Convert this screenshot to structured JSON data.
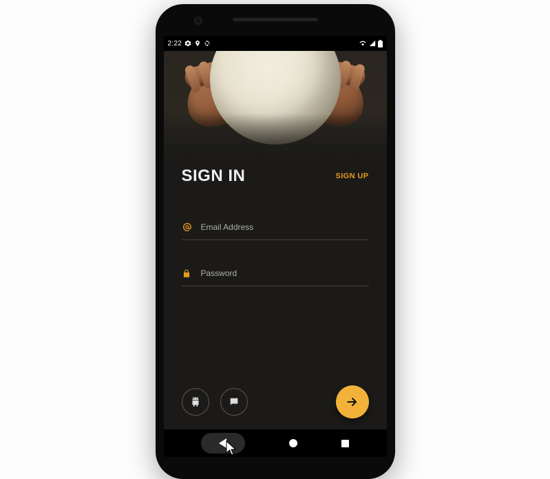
{
  "status": {
    "time": "2:22"
  },
  "heading": "SIGN IN",
  "signup_label": "SIGN UP",
  "fields": {
    "email": {
      "placeholder": "Email Address"
    },
    "password": {
      "placeholder": "Password"
    }
  },
  "colors": {
    "accent": "#e79a1f",
    "fab": "#f2b23a",
    "bg": "#1b1a18"
  },
  "icons": {
    "at": "at-icon",
    "lock": "lock-icon",
    "android": "android-icon",
    "chat": "chat-icon",
    "arrow": "arrow-right-icon"
  }
}
